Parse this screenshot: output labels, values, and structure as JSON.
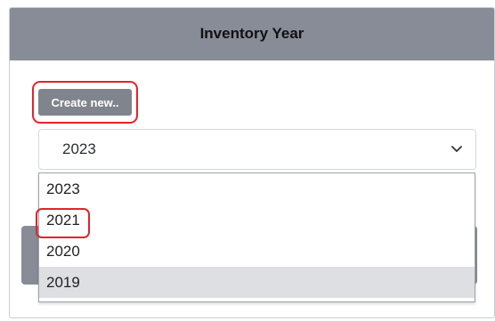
{
  "card": {
    "title": "Inventory Year"
  },
  "toolbar": {
    "create_label": "Create new.."
  },
  "year_select": {
    "selected": "2023",
    "chevron_icon": "chevron-down-icon"
  },
  "dropdown": {
    "options": [
      "2023",
      "2021",
      "2020",
      "2019"
    ],
    "highlighted_option": "2019"
  },
  "colors": {
    "header_bg": "#878c97",
    "button_bg": "#7f848d",
    "highlight_outline": "#e1242c",
    "option_hover_bg": "#dddfe3"
  }
}
